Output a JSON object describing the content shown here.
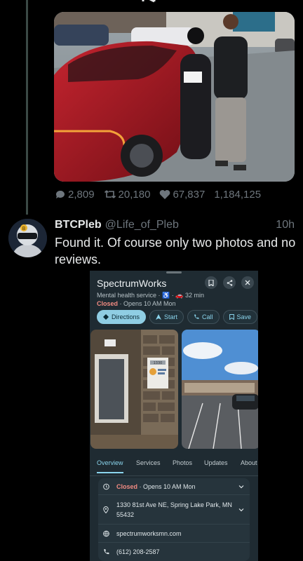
{
  "tweet": {
    "stats": {
      "replies": "2,809",
      "retweets": "20,180",
      "likes": "67,837",
      "views": "1,184,125"
    }
  },
  "reply": {
    "name": "BTCPleb",
    "handle": "@Life_of_Pleb",
    "time": "10h",
    "text": "Found it. Of course only two photos and no reviews."
  },
  "maps_card": {
    "business_name": "SpectrumWorks",
    "category": "Mental health service · ♿ · 🚗 32 min",
    "status": "Closed",
    "hours_summary": " · Opens 10 AM Mon",
    "actions": [
      "Directions",
      "Start",
      "Call",
      "Save"
    ],
    "storefront_number": "1330",
    "tabs": [
      "Overview",
      "Services",
      "Photos",
      "Updates",
      "About"
    ],
    "info": {
      "status": "Closed",
      "hours": " · Opens 10 AM Mon",
      "address": "1330 81st Ave NE, Spring Lake Park, MN 55432",
      "website": "spectrumworksmn.com",
      "phone": "(612) 208-2587"
    }
  },
  "colors": {
    "background": "#000000",
    "muted_text": "#6e767d",
    "maps_accent": "#8ad4ec",
    "closed_red": "#f28b82"
  }
}
